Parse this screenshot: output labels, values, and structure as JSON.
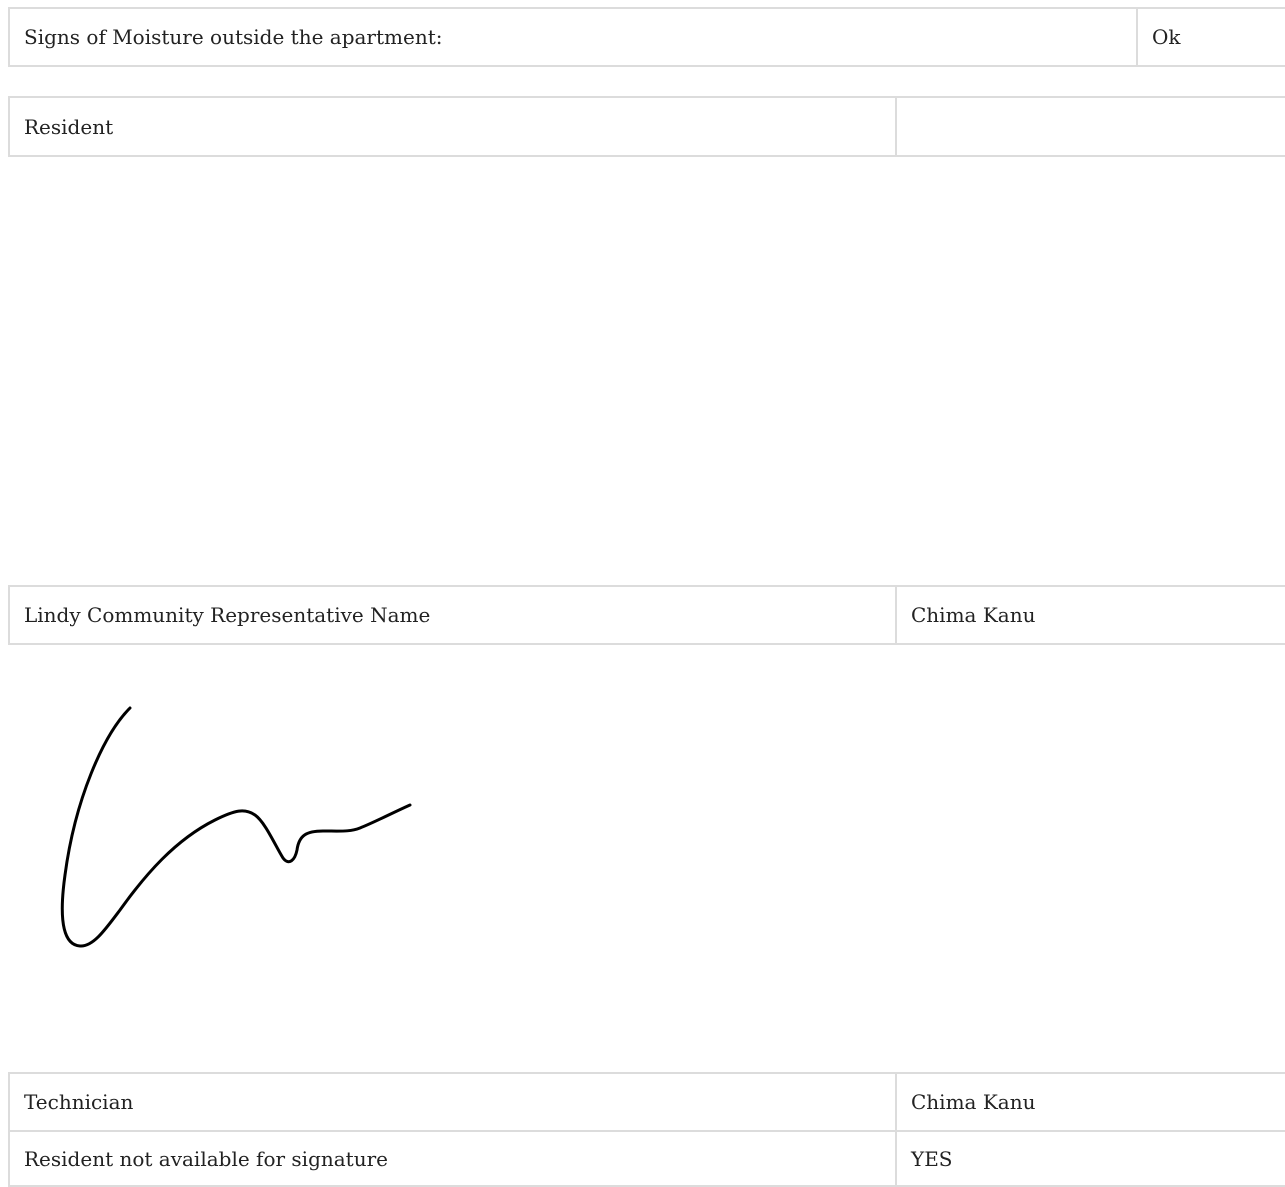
{
  "moisture": {
    "label": "Signs of Moisture outside the apartment:",
    "value": "Ok"
  },
  "resident": {
    "label": "Resident",
    "value": ""
  },
  "representative": {
    "label": "Lindy Community Representative Name",
    "value": "Chima Kanu"
  },
  "technician": {
    "label": "Technician",
    "value": "Chima Kanu"
  },
  "resident_unavailable": {
    "label": "Resident not available for signature",
    "value": "YES"
  }
}
